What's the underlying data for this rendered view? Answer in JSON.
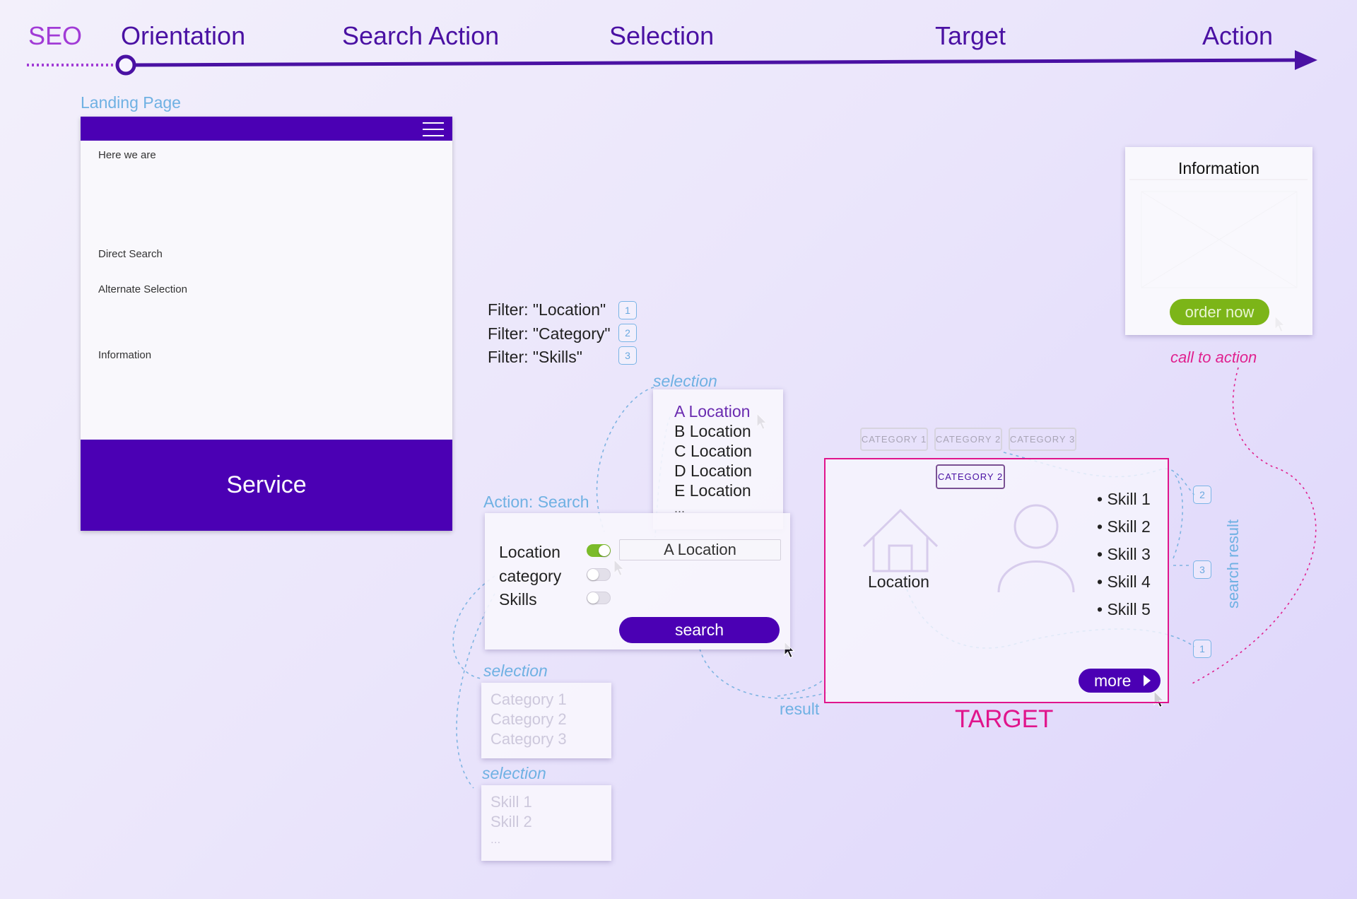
{
  "timeline": {
    "stages": [
      "SEO",
      "Orientation",
      "Search Action",
      "Selection",
      "Target",
      "Action"
    ],
    "colors": {
      "seo": "#a13bd6",
      "line": "#4a11a3"
    }
  },
  "landing": {
    "caption": "Landing Page",
    "here_we_are": "Here we are",
    "direct_search": "Direct Search",
    "alternate_selection": "Alternate Selection",
    "information": "Information",
    "service": "Service",
    "header_color": "#4b00b4"
  },
  "filters": {
    "items": [
      {
        "label": "Filter: \"Location\"",
        "badge": "1"
      },
      {
        "label": "Filter: \"Category\"",
        "badge": "2"
      },
      {
        "label": "Filter: \"Skills\"",
        "badge": "3"
      }
    ]
  },
  "location_dropdown": {
    "caption": "selection",
    "options": [
      "A Location",
      "B Location",
      "C Location",
      "D Location",
      "E Location",
      "..."
    ]
  },
  "search_panel": {
    "caption": "Action: Search",
    "rows": [
      {
        "label": "Location",
        "toggle": "on"
      },
      {
        "label": "category",
        "toggle": "off"
      },
      {
        "label": "Skills",
        "toggle": "off"
      }
    ],
    "location_value": "A Location",
    "search_label": "search"
  },
  "category_select": {
    "caption": "selection",
    "options": [
      "Category 1",
      "Category 2",
      "Category 3"
    ]
  },
  "skills_select": {
    "caption": "selection",
    "options": [
      "Skill 1",
      "Skill 2",
      "..."
    ]
  },
  "target": {
    "category_tabs": [
      "CATEGORY 1",
      "CATEGORY 2",
      "CATEGORY 3"
    ],
    "selected_category": "CATEGORY 2",
    "location_label": "Location",
    "skills": [
      "Skill 1",
      "Skill 2",
      "Skill 3",
      "Skill 4",
      "Skill 5"
    ],
    "more_label": "more",
    "title": "TARGET",
    "result_label": "result",
    "search_result_label": "search result",
    "badges": [
      "2",
      "3",
      "1"
    ],
    "accent": "#e0158c"
  },
  "info_card": {
    "title": "Information",
    "order_label": "order now",
    "call_to_action": "call to action",
    "order_color": "#7cb518"
  }
}
